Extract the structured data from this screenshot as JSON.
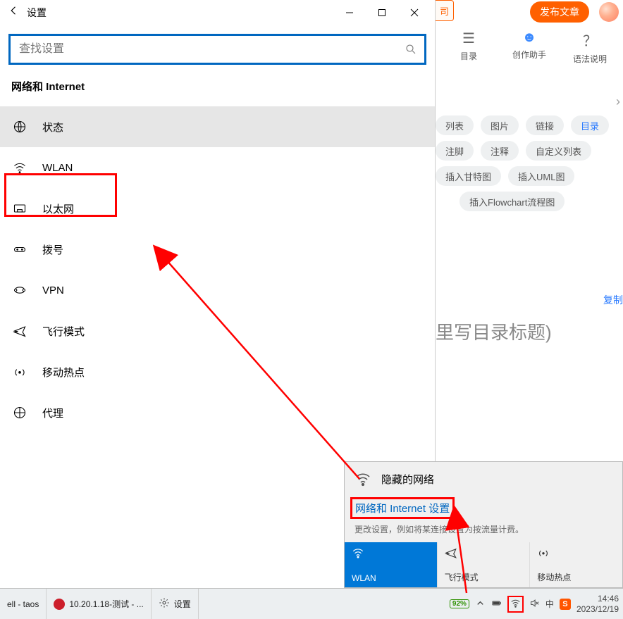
{
  "settings": {
    "title": "设置",
    "search_placeholder": "查找设置",
    "section": "网络和 Internet",
    "nav": [
      {
        "label": "状态"
      },
      {
        "label": "WLAN"
      },
      {
        "label": "以太网"
      },
      {
        "label": "拨号"
      },
      {
        "label": "VPN"
      },
      {
        "label": "飞行模式"
      },
      {
        "label": "移动热点"
      },
      {
        "label": "代理"
      }
    ]
  },
  "background_page": {
    "header_cut": "司",
    "publish_button": "发布文章",
    "top_icons": [
      {
        "label": "目录"
      },
      {
        "label": "创作助手"
      },
      {
        "label": "语法说明"
      }
    ],
    "tag_rows": [
      [
        "列表",
        "图片",
        "链接",
        "目录"
      ],
      [
        "注脚",
        "注释",
        "自定义列表"
      ],
      [
        "插入甘特图",
        "插入UML图"
      ],
      [
        "插入Flowchart流程图"
      ]
    ],
    "blue_tag": "目录",
    "copy": "复制",
    "heading_suffix": "里写目录标题)"
  },
  "flyout": {
    "hidden_network": "隐藏的网络",
    "link": "网络和 Internet 设置",
    "desc": "更改设置，例如将某连接设置为按流量计费。",
    "tiles": [
      {
        "label": "WLAN"
      },
      {
        "label": "飞行模式"
      },
      {
        "label": "移动热点"
      }
    ]
  },
  "taskbar": {
    "items": [
      {
        "label": "ell - taos"
      },
      {
        "label": "10.20.1.18-测试 - ..."
      },
      {
        "label": "设置"
      }
    ],
    "battery": "92%",
    "ime": "中",
    "sogou": "S",
    "time": "14:46",
    "date": "2023/12/19"
  }
}
